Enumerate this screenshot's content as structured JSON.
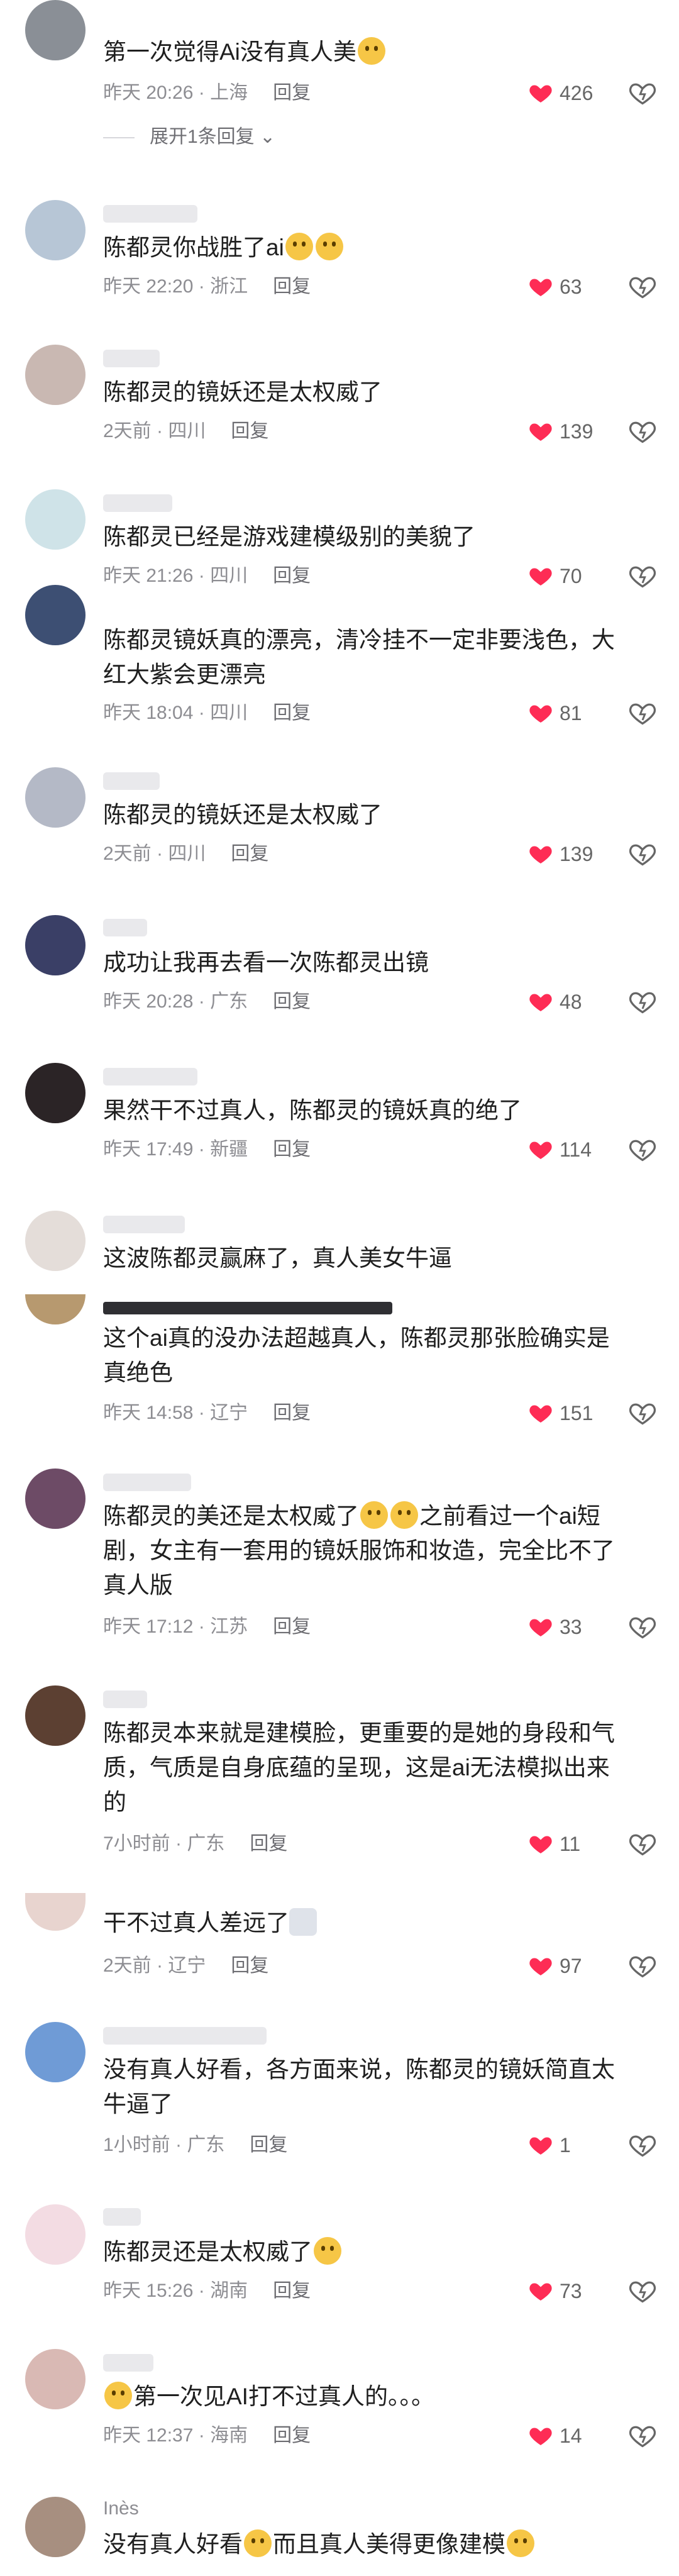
{
  "comments": [
    {
      "text": "第一次觉得Ai没有真人美",
      "emoji": "crying-face-emoji",
      "time": "昨天 20:26",
      "location": "上海",
      "reply": "回复",
      "likes": "426",
      "expand": "展开1条回复"
    },
    {
      "text": "陈都灵你战胜了ai",
      "emoji": "hands-over-mouth-emoji",
      "time": "昨天 22:20",
      "location": "浙江",
      "reply": "回复",
      "likes": "63"
    },
    {
      "text": "陈都灵的镜妖还是太权威了",
      "time": "2天前",
      "location": "四川",
      "reply": "回复",
      "likes": "139"
    },
    {
      "text": "陈都灵已经是游戏建模级别的美貌了",
      "time": "昨天 21:26",
      "location": "四川",
      "reply": "回复",
      "likes": "70"
    },
    {
      "text": "陈都灵镜妖真的漂亮，清冷挂不一定非要浅色，大红大紫会更漂亮",
      "time": "昨天 18:04",
      "location": "四川",
      "reply": "回复",
      "likes": "81"
    },
    {
      "text": "陈都灵的镜妖还是太权威了",
      "time": "2天前",
      "location": "四川",
      "reply": "回复",
      "likes": "139"
    },
    {
      "text": "成功让我再去看一次陈都灵出镜",
      "time": "昨天 20:28",
      "location": "广东",
      "reply": "回复",
      "likes": "48"
    },
    {
      "text": "果然干不过真人，陈都灵的镜妖真的绝了",
      "time": "昨天 17:49",
      "location": "新疆",
      "reply": "回复",
      "likes": "114"
    },
    {
      "text": "这波陈都灵赢麻了，真人美女牛逼"
    },
    {
      "text": "这个ai真的没办法超越真人，陈都灵那张脸确实是真绝色",
      "time": "昨天 14:58",
      "location": "辽宁",
      "reply": "回复",
      "likes": "151"
    },
    {
      "text_a": "陈都灵的美还是太权威了",
      "text_b": "之前看过一个ai短剧，女主有一套用的镜妖服饰和妆造，完全比不了真人版",
      "emoji": "thinking-face-emoji",
      "time": "昨天 17:12",
      "location": "江苏",
      "reply": "回复",
      "likes": "33"
    },
    {
      "text": "陈都灵本来就是建模脸，更重要的是她的身段和气质，气质是自身底蕴的呈现，这是ai无法模拟出来的",
      "time": "7小时前",
      "location": "广东",
      "reply": "回复",
      "likes": "11"
    },
    {
      "text": "干不过真人差远了",
      "emoji": "cat-emoji",
      "time": "2天前",
      "location": "辽宁",
      "reply": "回复",
      "likes": "97"
    },
    {
      "text": "没有真人好看，各方面来说，陈都灵的镜妖简直太牛逼了",
      "time": "1小时前",
      "location": "广东",
      "reply": "回复",
      "likes": "1"
    },
    {
      "text": "陈都灵还是太权威了",
      "emoji": "yum-face-emoji",
      "time": "昨天 15:26",
      "location": "湖南",
      "reply": "回复",
      "likes": "73"
    },
    {
      "text": "第一次见AI打不过真人的。。。",
      "emoji": "surprised-face-emoji",
      "time": "昨天 12:37",
      "location": "海南",
      "reply": "回复",
      "likes": "14"
    },
    {
      "username": "Inès",
      "text_a": "没有真人好看",
      "text_b": "而且真人美得更像建模",
      "emoji": "tears-of-joy-emoji"
    }
  ],
  "colors": {
    "heart": "#fe2c55",
    "meta": "#8d8d92",
    "text": "#1f1f1f"
  }
}
